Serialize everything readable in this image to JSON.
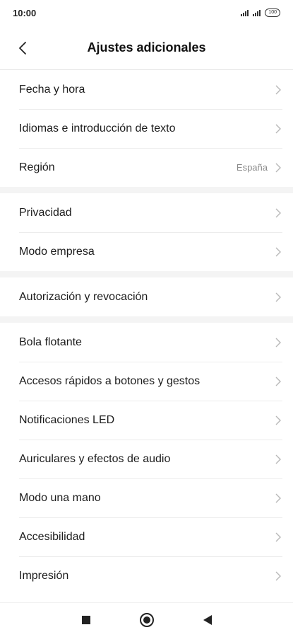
{
  "status_bar": {
    "time": "10:00",
    "battery": "100"
  },
  "header": {
    "title": "Ajustes adicionales"
  },
  "sections": [
    {
      "items": [
        {
          "label": "Fecha y hora",
          "value": ""
        },
        {
          "label": "Idiomas e introducción de texto",
          "value": ""
        },
        {
          "label": "Región",
          "value": "España"
        }
      ]
    },
    {
      "items": [
        {
          "label": "Privacidad",
          "value": ""
        },
        {
          "label": "Modo empresa",
          "value": ""
        }
      ]
    },
    {
      "items": [
        {
          "label": "Autorización y revocación",
          "value": ""
        }
      ]
    },
    {
      "items": [
        {
          "label": "Bola flotante",
          "value": ""
        },
        {
          "label": "Accesos rápidos a botones y gestos",
          "value": ""
        },
        {
          "label": "Notificaciones LED",
          "value": ""
        },
        {
          "label": "Auriculares y efectos de audio",
          "value": ""
        },
        {
          "label": "Modo una mano",
          "value": ""
        },
        {
          "label": "Accesibilidad",
          "value": ""
        },
        {
          "label": "Impresión",
          "value": ""
        }
      ]
    }
  ],
  "icons": {
    "back": "back-arrow-icon",
    "chevron": "chevron-right-icon",
    "nav_recents": "recents-square-icon",
    "nav_home": "home-circle-icon",
    "nav_back": "back-triangle-icon"
  },
  "colors": {
    "background": "#ffffff",
    "section_gap": "#f4f4f4",
    "value_text": "#8a8a8a",
    "chevron": "#b8b8b8"
  }
}
